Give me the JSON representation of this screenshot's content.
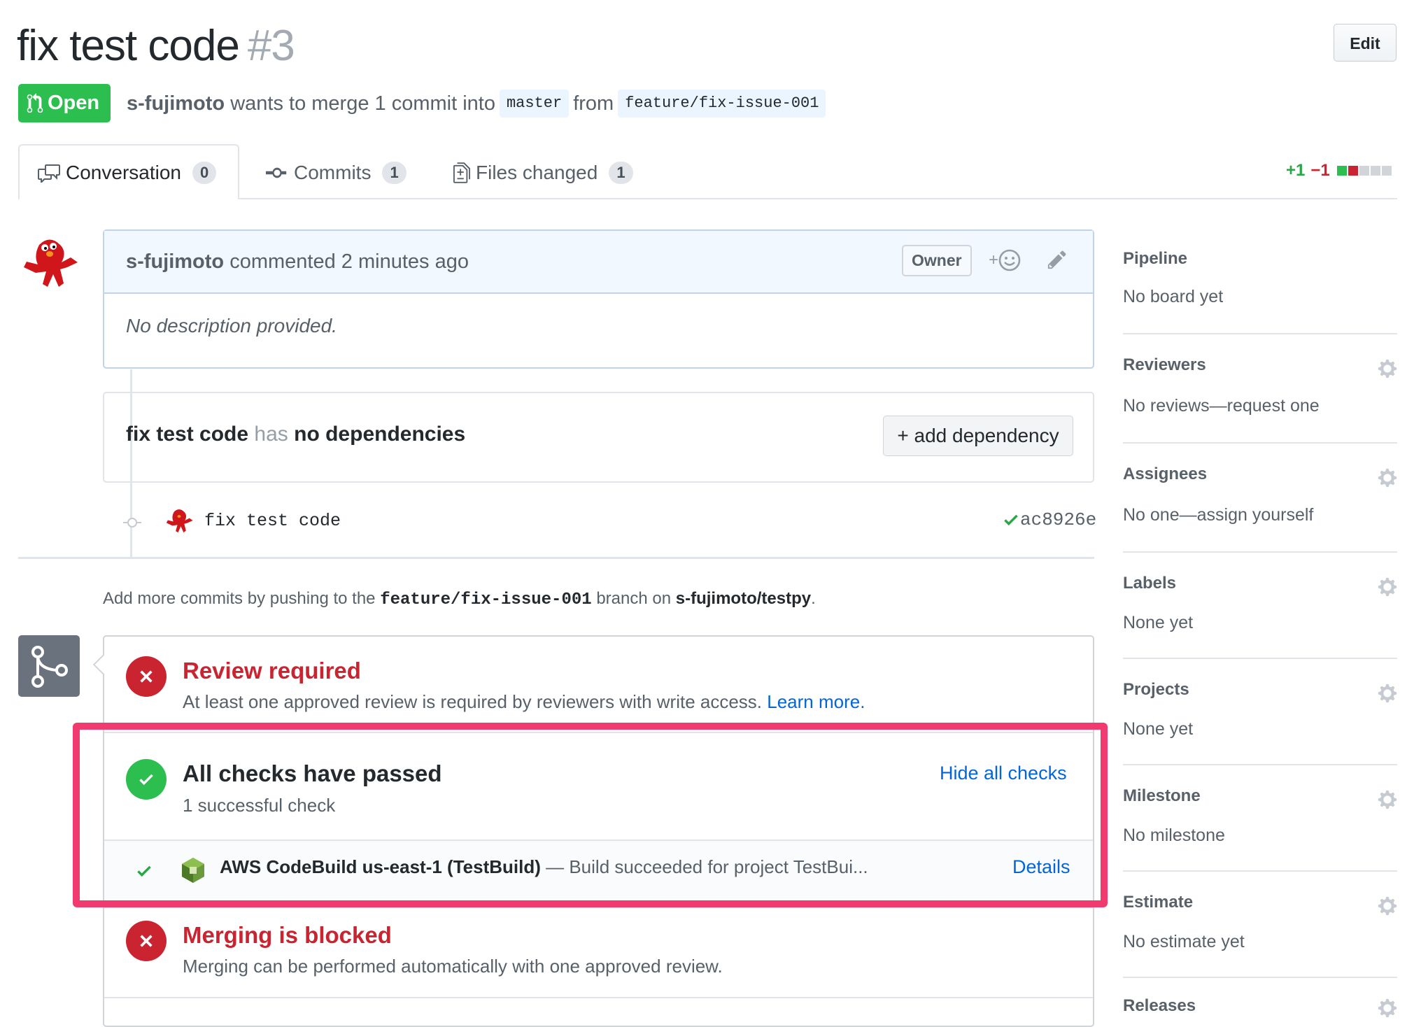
{
  "pr": {
    "title": "fix test code",
    "number": "#3",
    "edit_label": "Edit",
    "state": "Open",
    "author": "s-fujimoto",
    "merge_text": "wants to merge 1 commit into",
    "base_branch": "master",
    "from_text": "from",
    "head_branch": "feature/fix-issue-001"
  },
  "tabs": [
    {
      "label": "Conversation",
      "count": "0",
      "icon": "comment-discussion-icon"
    },
    {
      "label": "Commits",
      "count": "1",
      "icon": "git-commit-icon"
    },
    {
      "label": "Files changed",
      "count": "1",
      "icon": "file-diff-icon"
    }
  ],
  "diffstat": {
    "additions": "+1",
    "deletions": "−1",
    "blocks": [
      "added",
      "removed",
      "neutral",
      "neutral",
      "neutral"
    ]
  },
  "comment": {
    "author": "s-fujimoto",
    "action": "commented 2 minutes ago",
    "role_label": "Owner",
    "body": "No description provided."
  },
  "dependencies": {
    "pr_title": "fix test code",
    "has": "has",
    "status": "no dependencies",
    "add_button": "+ add dependency"
  },
  "commit": {
    "message": "fix test code",
    "sha": "ac8926e"
  },
  "push_hint": {
    "prefix": "Add more commits by pushing to the",
    "branch": "feature/fix-issue-001",
    "middle": "branch on",
    "repo": "s-fujimoto/testpy",
    "suffix": "."
  },
  "merge_box": {
    "review": {
      "title": "Review required",
      "desc": "At least one approved review is required by reviewers with write access.",
      "link": "Learn more."
    },
    "checks": {
      "title": "All checks have passed",
      "desc": "1 successful check",
      "toggle": "Hide all checks",
      "items": [
        {
          "name": "AWS CodeBuild us-east-1 (TestBuild)",
          "desc": "— Build succeeded for project TestBui...",
          "details": "Details"
        }
      ]
    },
    "blocked": {
      "title": "Merging is blocked",
      "desc": "Merging can be performed automatically with one approved review."
    }
  },
  "sidebar": [
    {
      "heading": "Pipeline",
      "value": "No board yet",
      "gear": false
    },
    {
      "heading": "Reviewers",
      "value": "No reviews—request one",
      "gear": true
    },
    {
      "heading": "Assignees",
      "value": "No one—assign yourself",
      "gear": true
    },
    {
      "heading": "Labels",
      "value": "None yet",
      "gear": true
    },
    {
      "heading": "Projects",
      "value": "None yet",
      "gear": true
    },
    {
      "heading": "Milestone",
      "value": "No milestone",
      "gear": true
    },
    {
      "heading": "Estimate",
      "value": "No estimate yet",
      "gear": true
    },
    {
      "heading": "Releases",
      "value": "",
      "gear": true
    }
  ],
  "colors": {
    "open_green": "#2cbe4e",
    "error_red": "#cb2431",
    "link_blue": "#0366d6",
    "highlight": "#f13a6f"
  }
}
